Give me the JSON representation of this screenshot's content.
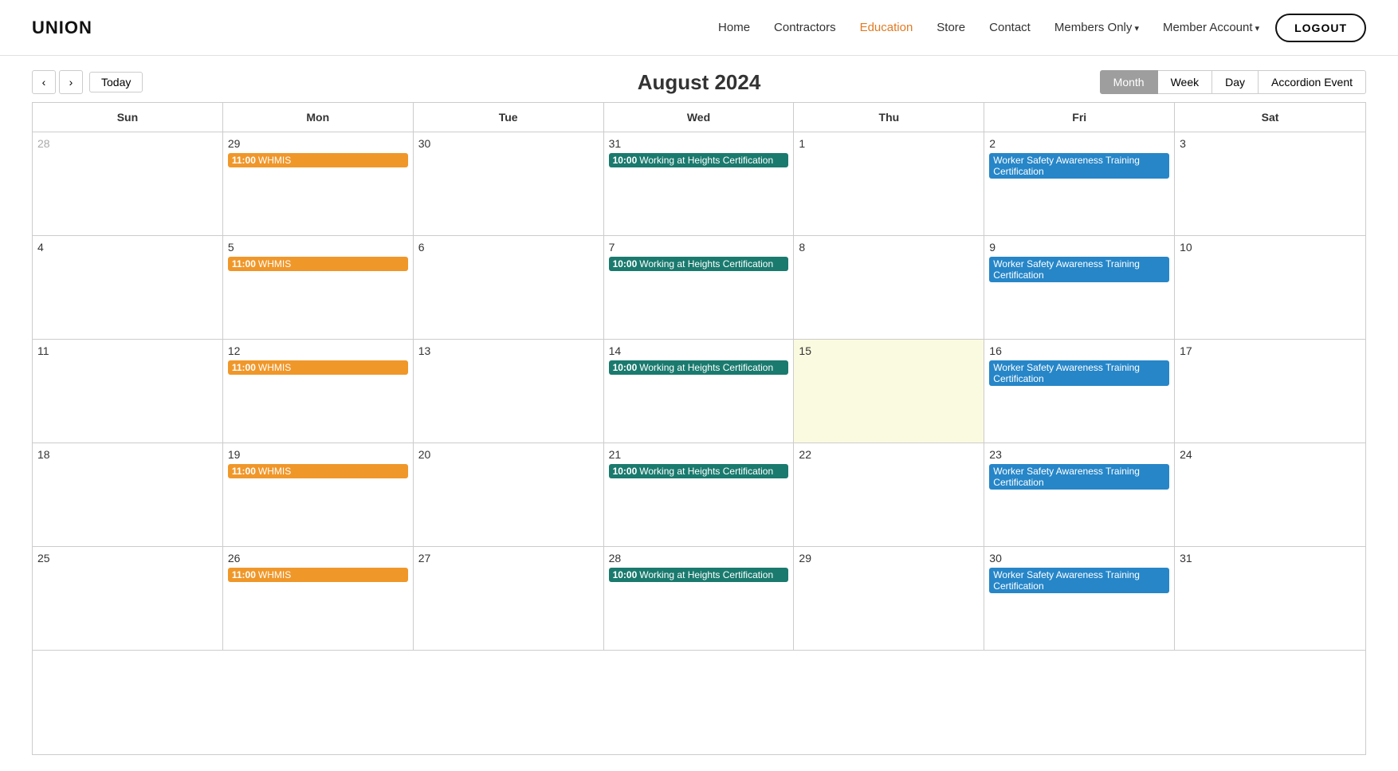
{
  "header": {
    "logo": "UNION",
    "nav": [
      {
        "label": "Home",
        "active": false
      },
      {
        "label": "Contractors",
        "active": false
      },
      {
        "label": "Education",
        "active": true
      },
      {
        "label": "Store",
        "active": false
      },
      {
        "label": "Contact",
        "active": false
      },
      {
        "label": "Members Only",
        "active": false,
        "hasArrow": true
      },
      {
        "label": "Member Account",
        "active": false,
        "hasArrow": true
      }
    ],
    "logout_label": "LOGOUT"
  },
  "calendar": {
    "title": "August 2024",
    "prev_label": "‹",
    "next_label": "›",
    "today_label": "Today",
    "views": [
      "Month",
      "Week",
      "Day",
      "Accordion Event"
    ],
    "active_view": "Month",
    "days_of_week": [
      "Sun",
      "Mon",
      "Tue",
      "Wed",
      "Thu",
      "Fri",
      "Sat"
    ],
    "weeks": [
      [
        {
          "date": 28,
          "outside": true,
          "today": false,
          "events": []
        },
        {
          "date": 29,
          "outside": false,
          "today": false,
          "events": [
            {
              "time": "11:00",
              "title": "WHMIS",
              "color": "orange"
            }
          ]
        },
        {
          "date": 30,
          "outside": false,
          "today": false,
          "events": []
        },
        {
          "date": 31,
          "outside": false,
          "today": false,
          "events": [
            {
              "time": "10:00",
              "title": "Working at Heights Certification",
              "color": "teal"
            }
          ]
        },
        {
          "date": 1,
          "outside": false,
          "today": false,
          "events": []
        },
        {
          "date": 2,
          "outside": false,
          "today": false,
          "events": [
            {
              "time": "",
              "title": "Worker Safety Awareness Training Certification",
              "color": "blue"
            }
          ]
        },
        {
          "date": 3,
          "outside": false,
          "today": false,
          "events": []
        }
      ],
      [
        {
          "date": 4,
          "outside": false,
          "today": false,
          "events": []
        },
        {
          "date": 5,
          "outside": false,
          "today": false,
          "events": [
            {
              "time": "11:00",
              "title": "WHMIS",
              "color": "orange"
            }
          ]
        },
        {
          "date": 6,
          "outside": false,
          "today": false,
          "events": []
        },
        {
          "date": 7,
          "outside": false,
          "today": false,
          "events": [
            {
              "time": "10:00",
              "title": "Working at Heights Certification",
              "color": "teal"
            }
          ]
        },
        {
          "date": 8,
          "outside": false,
          "today": false,
          "events": []
        },
        {
          "date": 9,
          "outside": false,
          "today": false,
          "events": [
            {
              "time": "",
              "title": "Worker Safety Awareness Training Certification",
              "color": "blue"
            }
          ]
        },
        {
          "date": 10,
          "outside": false,
          "today": false,
          "events": []
        }
      ],
      [
        {
          "date": 11,
          "outside": false,
          "today": false,
          "events": []
        },
        {
          "date": 12,
          "outside": false,
          "today": false,
          "events": [
            {
              "time": "11:00",
              "title": "WHMIS",
              "color": "orange"
            }
          ]
        },
        {
          "date": 13,
          "outside": false,
          "today": false,
          "events": []
        },
        {
          "date": 14,
          "outside": false,
          "today": false,
          "events": [
            {
              "time": "10:00",
              "title": "Working at Heights Certification",
              "color": "teal"
            }
          ]
        },
        {
          "date": 15,
          "outside": false,
          "today": true,
          "events": []
        },
        {
          "date": 16,
          "outside": false,
          "today": false,
          "events": [
            {
              "time": "",
              "title": "Worker Safety Awareness Training Certification",
              "color": "blue"
            }
          ]
        },
        {
          "date": 17,
          "outside": false,
          "today": false,
          "events": []
        }
      ],
      [
        {
          "date": 18,
          "outside": false,
          "today": false,
          "events": []
        },
        {
          "date": 19,
          "outside": false,
          "today": false,
          "events": [
            {
              "time": "11:00",
              "title": "WHMIS",
              "color": "orange"
            }
          ]
        },
        {
          "date": 20,
          "outside": false,
          "today": false,
          "events": []
        },
        {
          "date": 21,
          "outside": false,
          "today": false,
          "events": [
            {
              "time": "10:00",
              "title": "Working at Heights Certification",
              "color": "teal"
            }
          ]
        },
        {
          "date": 22,
          "outside": false,
          "today": false,
          "events": []
        },
        {
          "date": 23,
          "outside": false,
          "today": false,
          "events": [
            {
              "time": "",
              "title": "Worker Safety Awareness Training Certification",
              "color": "blue"
            }
          ]
        },
        {
          "date": 24,
          "outside": false,
          "today": false,
          "events": []
        }
      ],
      [
        {
          "date": 25,
          "outside": false,
          "today": false,
          "events": []
        },
        {
          "date": 26,
          "outside": false,
          "today": false,
          "events": [
            {
              "time": "11:00",
              "title": "WHMIS",
              "color": "orange"
            }
          ]
        },
        {
          "date": 27,
          "outside": false,
          "today": false,
          "events": []
        },
        {
          "date": 28,
          "outside": false,
          "today": false,
          "events": [
            {
              "time": "10:00",
              "title": "Working at Heights Certification",
              "color": "teal"
            }
          ]
        },
        {
          "date": 29,
          "outside": false,
          "today": false,
          "events": []
        },
        {
          "date": 30,
          "outside": false,
          "today": false,
          "events": [
            {
              "time": "",
              "title": "Worker Safety Awareness Training Certification",
              "color": "blue"
            }
          ]
        },
        {
          "date": 31,
          "outside": false,
          "today": false,
          "events": []
        }
      ]
    ]
  }
}
